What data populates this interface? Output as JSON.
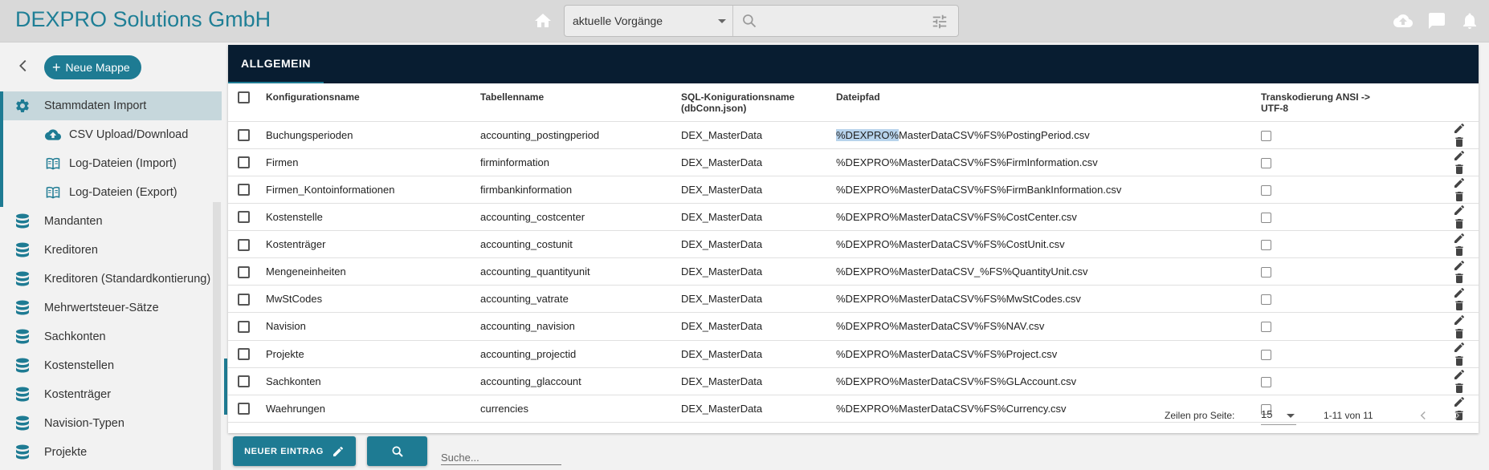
{
  "header": {
    "brand": "DEXPRO Solutions GmbH",
    "vorgang_select": "aktuelle Vorgänge",
    "search_placeholder": "",
    "icons": [
      "home-icon",
      "search-icon",
      "tune-icon",
      "cloud-upload-icon",
      "chat-icon",
      "bell-icon"
    ]
  },
  "sidebar": {
    "new_folder_label": "Neue Mappe",
    "items": [
      {
        "label": "Stammdaten Import",
        "icon": "gear-icon",
        "active": true
      },
      {
        "label": "CSV Upload/Download",
        "icon": "cloud-upload-icon",
        "sub": true
      },
      {
        "label": "Log-Dateien (Import)",
        "icon": "book-icon",
        "sub": true
      },
      {
        "label": "Log-Dateien (Export)",
        "icon": "book-icon",
        "sub": true
      },
      {
        "label": "Mandanten",
        "icon": "database-icon"
      },
      {
        "label": "Kreditoren",
        "icon": "database-icon"
      },
      {
        "label": "Kreditoren (Standardkontierung)",
        "icon": "database-icon"
      },
      {
        "label": "Mehrwertsteuer-Sätze",
        "icon": "database-icon"
      },
      {
        "label": "Sachkonten",
        "icon": "database-icon"
      },
      {
        "label": "Kostenstellen",
        "icon": "database-icon"
      },
      {
        "label": "Kostenträger",
        "icon": "database-icon"
      },
      {
        "label": "Navision-Typen",
        "icon": "database-icon"
      },
      {
        "label": "Projekte",
        "icon": "database-icon"
      }
    ]
  },
  "tabs": [
    {
      "label": "ALLGEMEIN",
      "active": true
    }
  ],
  "table": {
    "columns": {
      "name": "Konfigurationsname",
      "table": "Tabellenname",
      "sql_line1": "SQL-Konigurationsname",
      "sql_line2": "(dbConn.json)",
      "path": "Dateipfad",
      "trans_line1": "Transkodierung ANSI ->",
      "trans_line2": "UTF-8"
    },
    "rows": [
      {
        "name": "Buchungsperioden",
        "table": "accounting_postingperiod",
        "sql": "DEX_MasterData",
        "path_hl": "%DEXPRO%",
        "path_rest": "MasterDataCSV%FS%PostingPeriod.csv"
      },
      {
        "name": "Firmen",
        "table": "firminformation",
        "sql": "DEX_MasterData",
        "path_hl": "",
        "path_rest": "%DEXPRO%MasterDataCSV%FS%FirmInformation.csv"
      },
      {
        "name": "Firmen_Kontoinformationen",
        "table": "firmbankinformation",
        "sql": "DEX_MasterData",
        "path_hl": "",
        "path_rest": "%DEXPRO%MasterDataCSV%FS%FirmBankInformation.csv"
      },
      {
        "name": "Kostenstelle",
        "table": "accounting_costcenter",
        "sql": "DEX_MasterData",
        "path_hl": "",
        "path_rest": "%DEXPRO%MasterDataCSV%FS%CostCenter.csv"
      },
      {
        "name": "Kostenträger",
        "table": "accounting_costunit",
        "sql": "DEX_MasterData",
        "path_hl": "",
        "path_rest": "%DEXPRO%MasterDataCSV%FS%CostUnit.csv"
      },
      {
        "name": "Mengeneinheiten",
        "table": "accounting_quantityunit",
        "sql": "DEX_MasterData",
        "path_hl": "",
        "path_rest": "%DEXPRO%MasterDataCSV_%FS%QuantityUnit.csv"
      },
      {
        "name": "MwStCodes",
        "table": "accounting_vatrate",
        "sql": "DEX_MasterData",
        "path_hl": "",
        "path_rest": "%DEXPRO%MasterDataCSV%FS%MwStCodes.csv"
      },
      {
        "name": "Navision",
        "table": "accounting_navision",
        "sql": "DEX_MasterData",
        "path_hl": "",
        "path_rest": "%DEXPRO%MasterDataCSV%FS%NAV.csv"
      },
      {
        "name": "Projekte",
        "table": "accounting_projectid",
        "sql": "DEX_MasterData",
        "path_hl": "",
        "path_rest": "%DEXPRO%MasterDataCSV%FS%Project.csv"
      },
      {
        "name": "Sachkonten",
        "table": "accounting_glaccount",
        "sql": "DEX_MasterData",
        "path_hl": "",
        "path_rest": "%DEXPRO%MasterDataCSV%FS%GLAccount.csv"
      },
      {
        "name": "Waehrungen",
        "table": "currencies",
        "sql": "DEX_MasterData",
        "path_hl": "",
        "path_rest": "%DEXPRO%MasterDataCSV%FS%Currency.csv"
      }
    ]
  },
  "pagination": {
    "rows_per_page_label": "Zeilen pro Seite:",
    "rows_per_page": "15",
    "range": "1-11 von 11"
  },
  "actions": {
    "new_entry_label": "NEUER EINTRAG",
    "search_placeholder": "Suche..."
  },
  "colors": {
    "accent": "#1e7b93",
    "brand": "#1f7f96",
    "tabbar": "#081d31"
  }
}
